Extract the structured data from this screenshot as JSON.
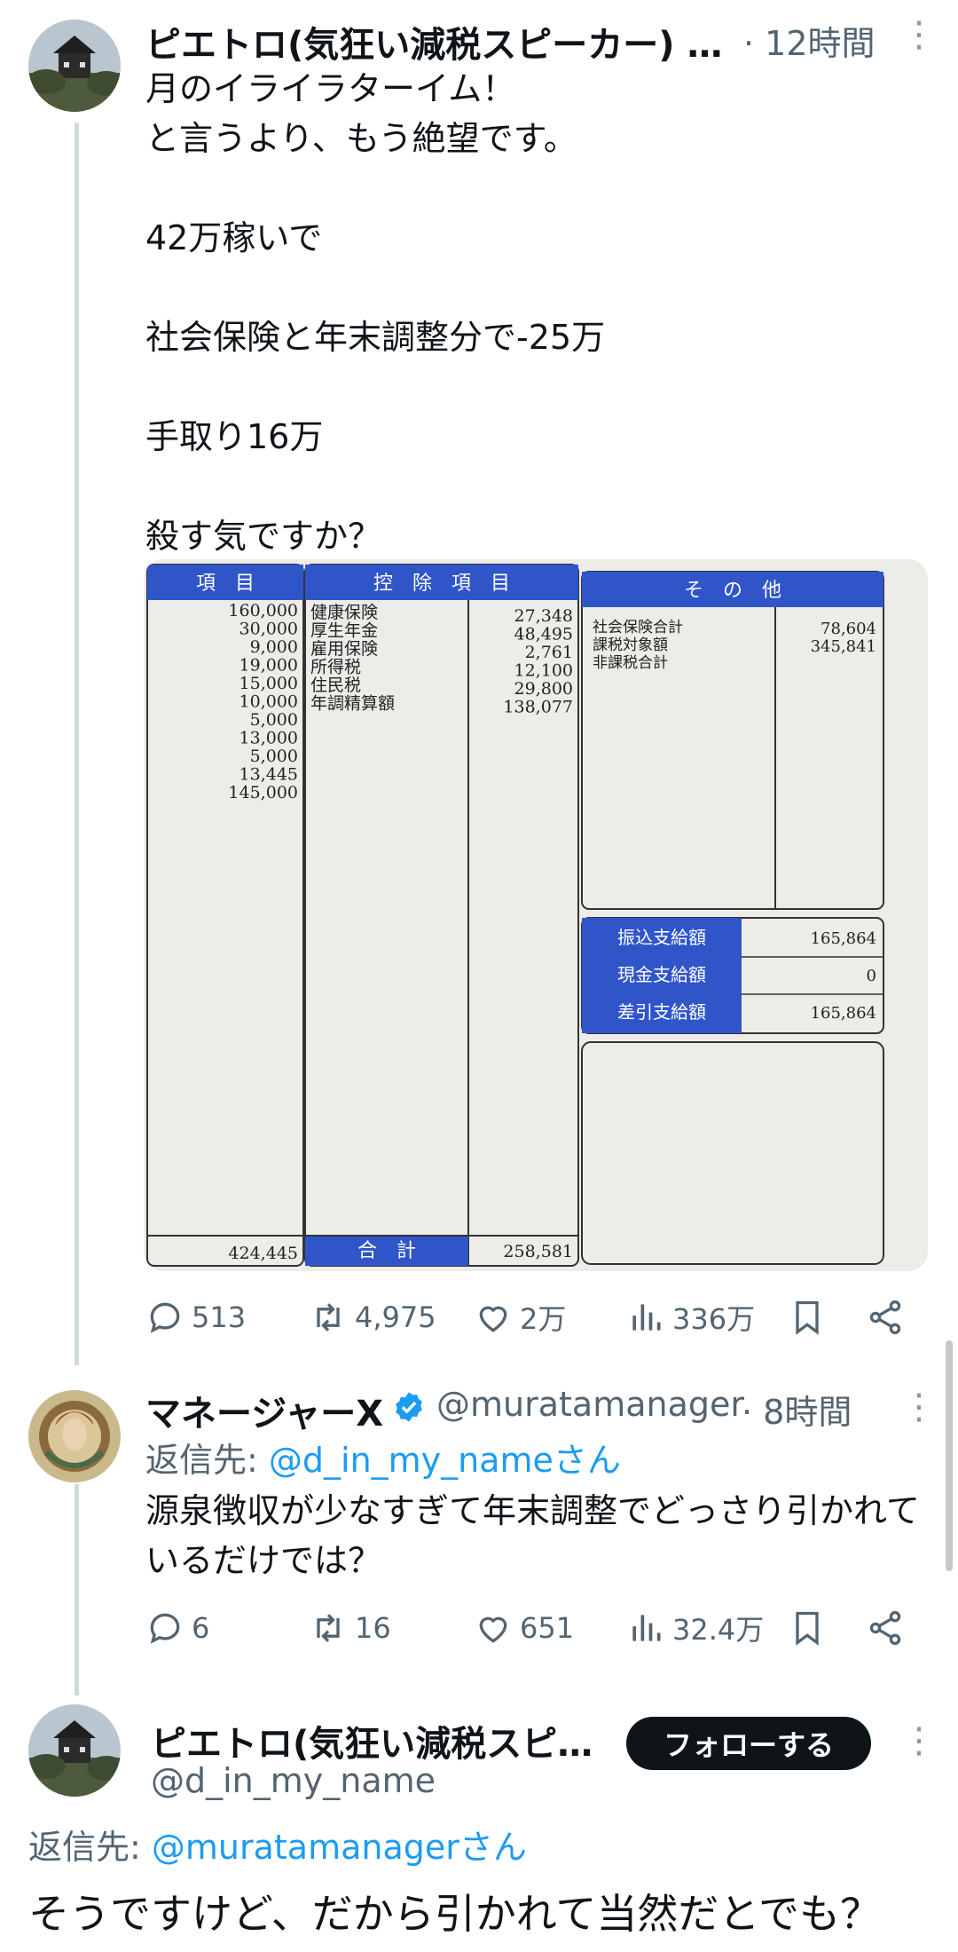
{
  "tweet1": {
    "author_name": "ピエトロ(気狂い減税スピーカー) …",
    "time": "· 12時間",
    "text": "月のイライラターイム！\nと言うより、もう絶望です。\n\n42万稼いで\n\n社会保険と年末調整分で-25万\n\n手取り16万\n\n殺す気ですか？",
    "stats": {
      "replies": "513",
      "retweets": "4,975",
      "likes": "2万",
      "views": "336万"
    }
  },
  "slip": {
    "headers": {
      "col1": "項　目",
      "col2": "控　除　項　目",
      "col3": "そ　の　他"
    },
    "earnings": [
      "160,000",
      "30,000",
      "9,000",
      "19,000",
      "15,000",
      "10,000",
      "5,000",
      "13,000",
      "5,000",
      "13,445",
      "145,000"
    ],
    "deductions": [
      {
        "label": "健康保険",
        "value": "27,348"
      },
      {
        "label": "厚生年金",
        "value": "48,495"
      },
      {
        "label": "雇用保険",
        "value": "2,761"
      },
      {
        "label": "所得税",
        "value": "12,100"
      },
      {
        "label": "住民税",
        "value": "29,800"
      },
      {
        "label": "年調精算額",
        "value": "138,077"
      }
    ],
    "other": [
      {
        "label": "社会保険合計",
        "value": "78,604"
      },
      {
        "label": "課税対象額",
        "value": "345,841"
      },
      {
        "label": "非課税合計",
        "value": ""
      }
    ],
    "payments": [
      {
        "label": "振込支給額",
        "value": "165,864"
      },
      {
        "label": "現金支給額",
        "value": "0"
      },
      {
        "label": "差引支給額",
        "value": "165,864"
      }
    ],
    "totals": {
      "earnings_total": "424,445",
      "total_label": "合　計",
      "deductions_total": "258,581"
    }
  },
  "tweet2": {
    "author_name": "マネージャーX",
    "handle": "@muratamanager",
    "time": "· 8時間",
    "reply_prefix": "返信先: ",
    "reply_to": "@d_in_my_nameさん",
    "text": "源泉徴収が少なすぎて年末調整でどっさり引かれているだけでは？",
    "stats": {
      "replies": "6",
      "retweets": "16",
      "likes": "651",
      "views": "32.4万"
    }
  },
  "tweet3": {
    "author_name": "ピエトロ(気狂い減税スピ…",
    "handle": "@d_in_my_name",
    "follow_label": "フォローする",
    "reply_prefix": "返信先: ",
    "reply_to": "@muratamanagerさん",
    "text": "そうですけど、だから引かれて当然だとでも？"
  },
  "icons": {
    "reply": "reply-icon",
    "retweet": "retweet-icon",
    "like": "heart-icon",
    "views": "views-icon",
    "bookmark": "bookmark-icon",
    "share": "share-icon",
    "more": "more-icon",
    "verified": "verified-badge-icon"
  },
  "colors": {
    "accent": "#1d9bf0",
    "verified": "#1d9bf0",
    "slip_blue": "#2f55c9",
    "follow_bg": "#0f1419"
  }
}
